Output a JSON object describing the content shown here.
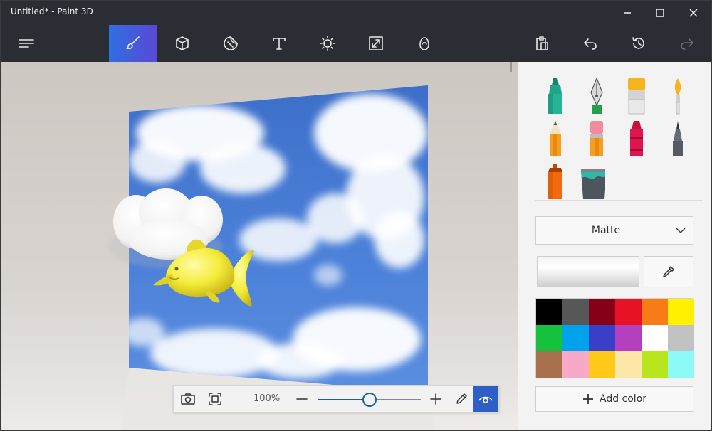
{
  "window": {
    "title": "Untitled* - Paint 3D",
    "controls": [
      "minimize-icon",
      "maximize-icon",
      "close-icon"
    ]
  },
  "toolbar": {
    "menu_icon": "hamburger-menu-icon",
    "tools": [
      {
        "icon": "brush-icon",
        "name": "Brushes",
        "active": true
      },
      {
        "icon": "cube-icon",
        "name": "3D shapes",
        "active": false
      },
      {
        "icon": "sticker-icon",
        "name": "Stickers",
        "active": false
      },
      {
        "icon": "text-icon",
        "name": "Text",
        "active": false
      },
      {
        "icon": "sun-icon",
        "name": "Effects",
        "active": false
      },
      {
        "icon": "resize-icon",
        "name": "Canvas",
        "active": false
      },
      {
        "icon": "remix-icon",
        "name": "Remix 3D",
        "active": false
      }
    ],
    "right_tools": [
      "paste-icon",
      "undo-icon",
      "history-icon",
      "redo-icon"
    ]
  },
  "zoom": {
    "percent_label": "100%",
    "level": 0.5
  },
  "panel": {
    "brushes": [
      "marker-icon",
      "calligraphy-pen-icon",
      "oil-brush-icon",
      "watercolor-icon",
      "pencil-icon",
      "eraser-icon",
      "crayon-icon",
      "pixel-pen-icon",
      "spray-can-icon",
      "fill-bucket-icon"
    ],
    "finish_label": "Matte",
    "current_color": "#f4f4f4",
    "palette": [
      "#000000",
      "#575757",
      "#860018",
      "#e71224",
      "#f87c16",
      "#fff100",
      "#16c13e",
      "#00a2ec",
      "#3a3fc8",
      "#b440bf",
      "#ffffff",
      "#c2c2c2",
      "#a8704c",
      "#f9a9c8",
      "#ffc91a",
      "#fce6a8",
      "#b7e61d",
      "#8cfbf8"
    ],
    "add_color_label": "Add color"
  },
  "colors": {
    "accent": "#2f6fe0",
    "titlebar": "#2b2d34"
  }
}
